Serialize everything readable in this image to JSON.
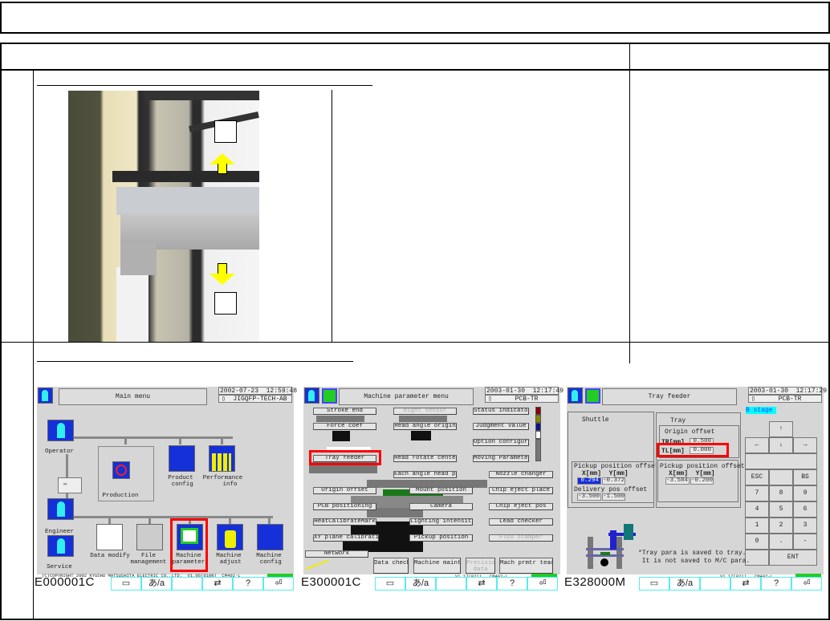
{
  "screen1": {
    "title": "Main menu",
    "date": "2002-07-23  12:59:48",
    "file": "JIGQFP-TECH-AB",
    "copyright": "(C)COPYRIGHT 2002 KYUSHU MATSUSHITA ELECTRIC CO.,LTD.  V1.06(010N)  CM402-L",
    "items": [
      "Operator",
      "Engineer",
      "Service",
      "Production",
      "Product\n config",
      "Performance\n    info",
      "Data modify",
      "File\nmanagement",
      "Machine\nparameter",
      "Machine\n adjust",
      "Machine\n config"
    ],
    "code": "E000001C"
  },
  "screen2": {
    "title": "Machine parameter menu",
    "date": "2003-01-30  12:17:49",
    "file": "PCB-TR",
    "buttons": [
      "Stroke end",
      "Hight sensor",
      "Status indicator",
      "Force coef",
      "Head angle origin",
      "Judgment value",
      "Option configurat",
      "Tray feeder",
      "Head rotate center",
      "Moving Parameter",
      "Each angle head pos",
      "Nozzle changer",
      "Origin offset",
      "Mount position",
      "Chip eject place",
      "PCB positioning",
      "Camera",
      "Chip eject pos",
      "HeatCalibrateMark",
      "Lighting intensity",
      "Lead checker",
      "XY plane calibration",
      "Pickup position",
      "Flux stamper",
      "Network"
    ],
    "bottom_buttons": [
      "Data check",
      "Machine mainte",
      "Precision\ndata",
      "Mach prmtr teach"
    ],
    "version": "V1.17(021)   CM402-L",
    "code": "E300001C"
  },
  "screen3": {
    "title": "Tray feeder",
    "date": "2003-01-30  12:17:29",
    "file": "PCB-TR",
    "stage": "B stage",
    "shuttle": {
      "label": "Shuttle",
      "pickup_label": "Pickup position offset",
      "cols": "X[mm]  Y[mm]",
      "pickup_x": "0.294",
      "pickup_y": "-0.372",
      "delivery_label": "Delivery pos offset",
      "delivery_x": "-3.500",
      "delivery_y": "-1.500"
    },
    "tray": {
      "label": "Tray",
      "origin_label": "Origin offset",
      "tr_label": "TR[mm]",
      "tr_value": "0.500",
      "tl_label": "TL[mm]",
      "tl_value": "0.000",
      "pickup_label": "Pickup position offset",
      "cols": "X[mm]  Y[mm]",
      "pickup_x": "-3.584",
      "pickup_y": "-0.200"
    },
    "keys": [
      "↑",
      "←",
      "↓",
      "→",
      "ESC",
      "",
      "BS",
      "7",
      "8",
      "9",
      "4",
      "5",
      "6",
      "1",
      "2",
      "3",
      "0",
      ".",
      "-",
      "",
      "ENT"
    ],
    "note1": "*Tray para is saved to tray.",
    "note2": " It is not saved to M/C para.",
    "version": "V1.17(021)   CM402-L",
    "code": "E328000M"
  },
  "footer_buttons": [
    {
      "icon": "window-icon",
      "glyph": "▭"
    },
    {
      "icon": "kana-input-icon",
      "glyph": "あ/a"
    },
    {
      "icon": "blank-icon",
      "glyph": ""
    },
    {
      "icon": "switch-icon",
      "glyph": "⇄"
    },
    {
      "icon": "help-icon",
      "glyph": "?"
    },
    {
      "icon": "return-icon",
      "glyph": "⏎"
    }
  ],
  "colors": {
    "lcd": "#d6d6d6",
    "highlight": "#ff0000",
    "arrow": "#ffff00",
    "cyan": "#55eeee"
  }
}
